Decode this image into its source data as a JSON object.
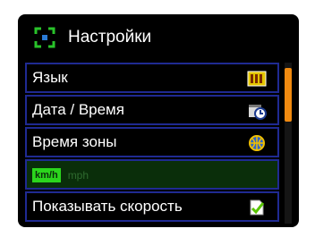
{
  "header": {
    "title": "Настройки",
    "icon": "settings-target-icon"
  },
  "menu": {
    "items": [
      {
        "label": "Язык",
        "icon": "abc-icon"
      },
      {
        "label": "Дата / Время",
        "icon": "calendar-clock-icon"
      },
      {
        "label": "Время зоны",
        "icon": "globe-icon"
      },
      {
        "label": "",
        "icon": ""
      },
      {
        "label": "Показывать скорость",
        "icon": "checkbox-checked-icon"
      }
    ],
    "speed_units": {
      "selected": "km/h",
      "other": "mph"
    }
  },
  "colors": {
    "background": "#000000",
    "row_border": "#1f2a92",
    "selected_row": "#0a2e0a",
    "selected_unit": "#2bd61d",
    "scrollbar": "#f08a10"
  }
}
